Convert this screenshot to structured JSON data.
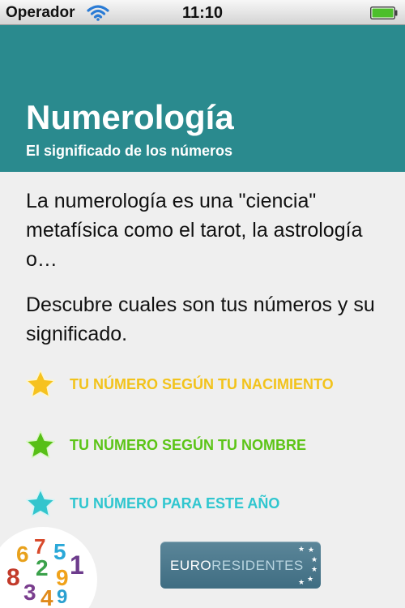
{
  "statusbar": {
    "carrier": "Operador",
    "time": "11:10",
    "wifi_icon": "wifi-icon",
    "battery_icon": "battery-icon"
  },
  "header": {
    "title": "Numerología",
    "subtitle": "El significado de los números",
    "bg_color": "#2a8a8e"
  },
  "intro": "La numerología es una \"ciencia\" metafísica como el tarot, la astrología o…",
  "cta": "Descubre cuales son tus números y su significado.",
  "menu": [
    {
      "label": "TU NÚMERO SEGÚN TU NACIMIENTO",
      "color": "#f2c31c",
      "icon": "star-icon"
    },
    {
      "label": "TU NÚMERO SEGÚN TU NOMBRE",
      "color": "#5cc417",
      "icon": "star-icon"
    },
    {
      "label": "TU NÚMERO PARA ESTE AÑO",
      "color": "#2fc6cf",
      "icon": "star-icon"
    }
  ],
  "logos": {
    "numbers_digits": [
      "6",
      "7",
      "5",
      "1",
      "8",
      "2",
      "9",
      "3",
      "4",
      "9"
    ],
    "euro_part1": "EURO",
    "euro_part2": "RESIDENTES"
  }
}
